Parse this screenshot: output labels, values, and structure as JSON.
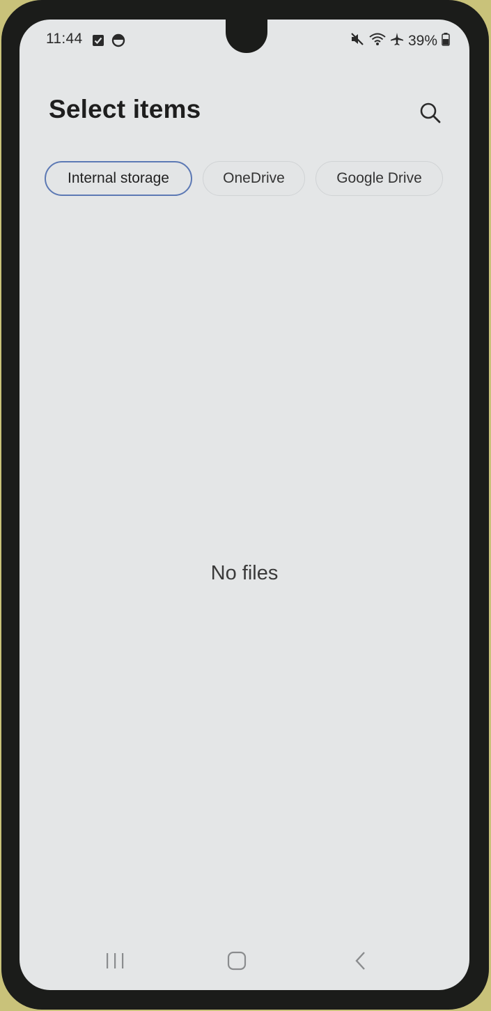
{
  "status_bar": {
    "time": "11:44",
    "battery": "39%",
    "icons_left": [
      "checkbox-notification-icon",
      "sync-notification-icon"
    ],
    "icons_right": [
      "mute-icon",
      "wifi-icon",
      "airplane-icon",
      "battery-icon"
    ]
  },
  "header": {
    "title": "Select items",
    "search_icon": "search-icon"
  },
  "storage_tabs": [
    {
      "label": "Internal storage",
      "selected": true
    },
    {
      "label": "OneDrive",
      "selected": false
    },
    {
      "label": "Google Drive",
      "selected": false
    }
  ],
  "content": {
    "empty_message": "No files"
  },
  "nav_bar": {
    "buttons": [
      "recents-icon",
      "home-icon",
      "back-icon"
    ]
  },
  "colors": {
    "background": "#e4e6e7",
    "selected_tab_border": "#5c79b4",
    "text": "#1e1e1e"
  }
}
